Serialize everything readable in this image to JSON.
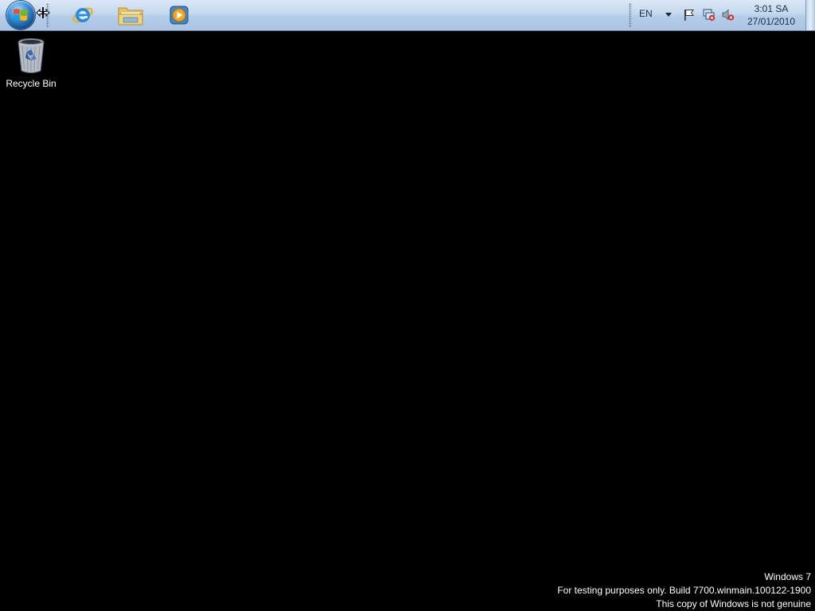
{
  "taskbar": {
    "start_icon": "windows-logo-icon",
    "pinned": [
      {
        "name": "internet-explorer",
        "icon": "internet-explorer-icon"
      },
      {
        "name": "windows-explorer",
        "icon": "folder-icon"
      },
      {
        "name": "windows-media-player",
        "icon": "media-player-icon"
      }
    ],
    "tray": {
      "language": "EN",
      "icons": [
        "chevron-down-icon",
        "action-center-flag-icon",
        "network-disconnected-icon",
        "volume-muted-icon"
      ],
      "clock": {
        "time": "3:01 SA",
        "date": "27/01/2010"
      }
    }
  },
  "desktop": {
    "icons": [
      {
        "label": "Recycle Bin",
        "icon": "recycle-bin-icon"
      }
    ]
  },
  "watermark": {
    "line1": "Windows 7",
    "line2": "For testing purposes only. Build 7700.winmain.100122-1900",
    "line3": "This copy of Windows is not genuine"
  },
  "colors": {
    "taskbar_top": "#dbe8f6",
    "taskbar_bottom": "#a9c3e2",
    "desktop_background": "#000000",
    "text_light": "#ffffff"
  }
}
